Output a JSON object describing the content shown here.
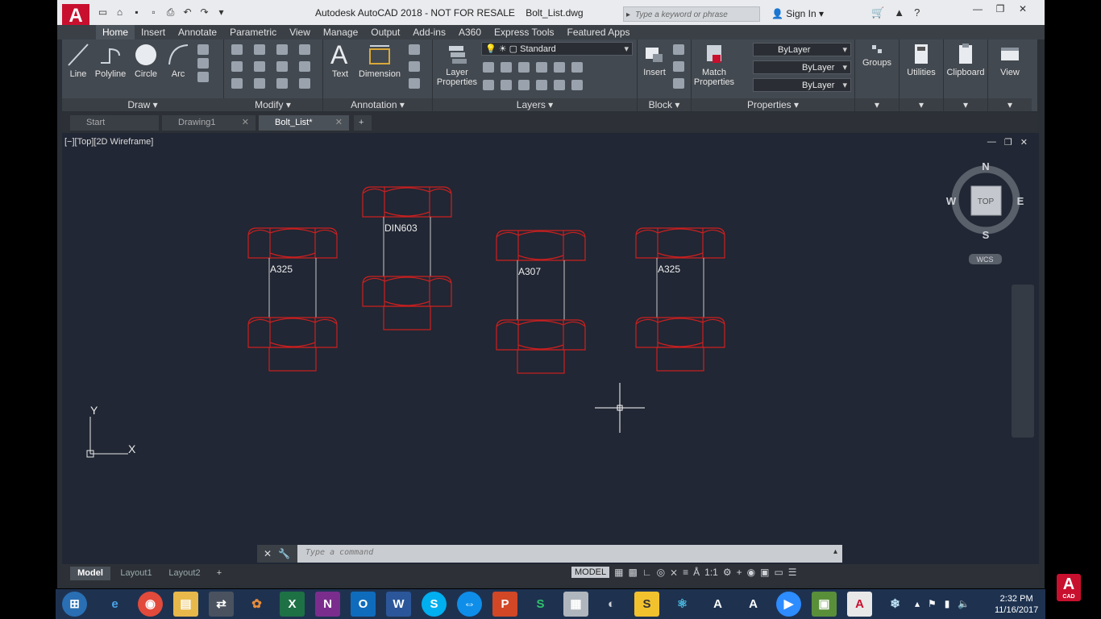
{
  "window": {
    "title": "Autodesk AutoCAD 2018 - NOT FOR RESALE",
    "filename": "Bolt_List.dwg",
    "app_button": "A",
    "search_placeholder": "Type a keyword or phrase",
    "sign_in": "Sign In"
  },
  "ribbon_tabs": [
    "Home",
    "Insert",
    "Annotate",
    "Parametric",
    "View",
    "Manage",
    "Output",
    "Add-ins",
    "A360",
    "Express Tools",
    "Featured Apps"
  ],
  "ribbon": {
    "draw": {
      "title": "Draw",
      "line": "Line",
      "polyline": "Polyline",
      "circle": "Circle",
      "arc": "Arc"
    },
    "modify": {
      "title": "Modify"
    },
    "annotation": {
      "title": "Annotation",
      "text": "Text",
      "dimension": "Dimension"
    },
    "layers": {
      "title": "Layers",
      "layer_properties_1": "Layer",
      "layer_properties_2": "Properties",
      "current_layer": "Standard"
    },
    "block": {
      "title": "Block",
      "insert": "Insert"
    },
    "properties": {
      "title": "Properties",
      "match_1": "Match",
      "match_2": "Properties",
      "color": "ByLayer",
      "linetype": "ByLayer",
      "lineweight": "ByLayer"
    },
    "groups": "Groups",
    "utilities": "Utilities",
    "clipboard": "Clipboard",
    "view": "View"
  },
  "doc_tabs": [
    "Start",
    "Drawing1",
    "Bolt_List*"
  ],
  "viewport": {
    "label": "[−][Top][2D Wireframe]",
    "compass": {
      "n": "N",
      "s": "S",
      "e": "E",
      "w": "W",
      "top": "TOP",
      "wcs": "WCS"
    },
    "ucs": {
      "x": "X",
      "y": "Y"
    }
  },
  "bolts": [
    "A325",
    "DIN603",
    "A307",
    "A325"
  ],
  "command_line": {
    "placeholder": "Type a command"
  },
  "layout_tabs": [
    "Model",
    "Layout1",
    "Layout2"
  ],
  "status": {
    "model": "MODEL",
    "scale": "1:1"
  },
  "clock": {
    "time": "2:32 PM",
    "date": "11/16/2017"
  },
  "badge": {
    "letter": "A",
    "caption": "CAD"
  },
  "colors": {
    "accent": "#c8102e",
    "bolt_outline": "#cc1f1f",
    "canvas": "#212734",
    "shank": "#c7c7c7"
  }
}
